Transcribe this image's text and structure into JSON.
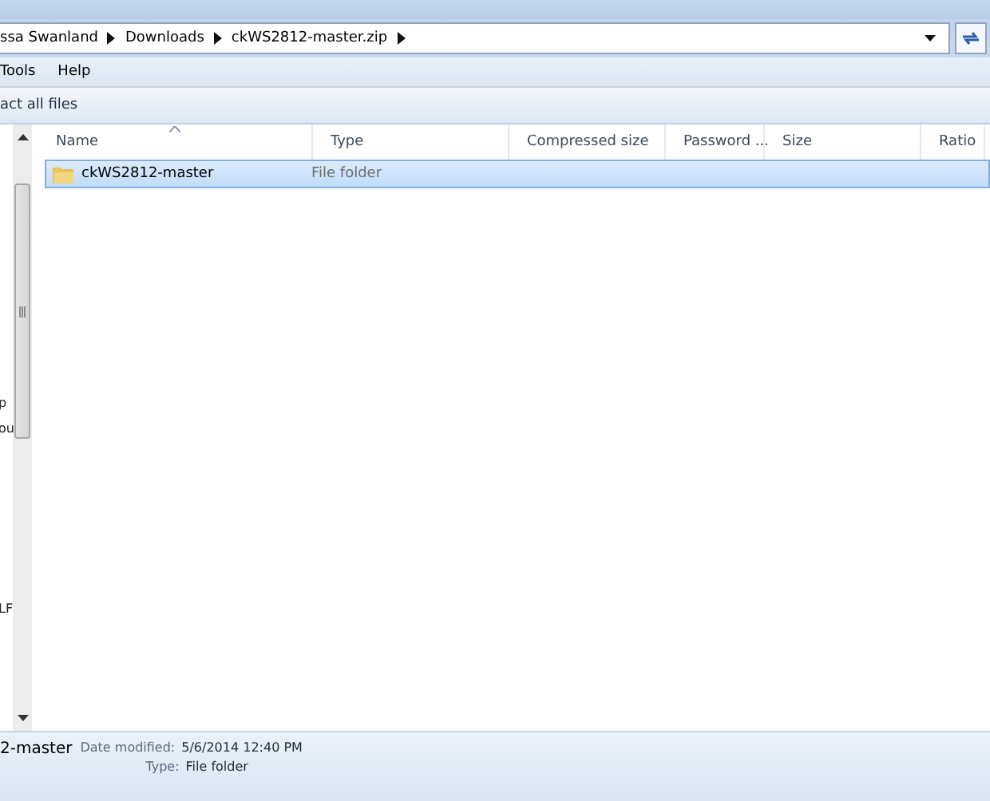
{
  "address_bar": {
    "crumbs": [
      "ssa Swanland",
      "Downloads",
      "ckWS2812-master.zip"
    ]
  },
  "menu_bar": [
    "Tools",
    "Help"
  ],
  "toolbar": {
    "button": "act all files"
  },
  "navigation_pane": {
    "items": [
      {
        "label": "p"
      },
      {
        "label": "ou"
      },
      {
        "label": "LF"
      }
    ]
  },
  "table": {
    "columns": [
      {
        "label": "Name",
        "sorted": true
      },
      {
        "label": "Type",
        "sorted": false
      },
      {
        "label": "Compressed size",
        "sorted": false
      },
      {
        "label": "Password ...",
        "sorted": false
      },
      {
        "label": "Size",
        "sorted": false
      },
      {
        "label": "Ratio",
        "sorted": false
      }
    ],
    "rows": [
      {
        "name": "ckWS2812-master",
        "type": "File folder",
        "selected": true
      }
    ]
  },
  "details_pane": {
    "name": "2-master",
    "fields": [
      {
        "label": "Date modified:",
        "value": "5/6/2014 12:40 PM"
      },
      {
        "label": "Type:",
        "value": "File folder"
      }
    ]
  }
}
